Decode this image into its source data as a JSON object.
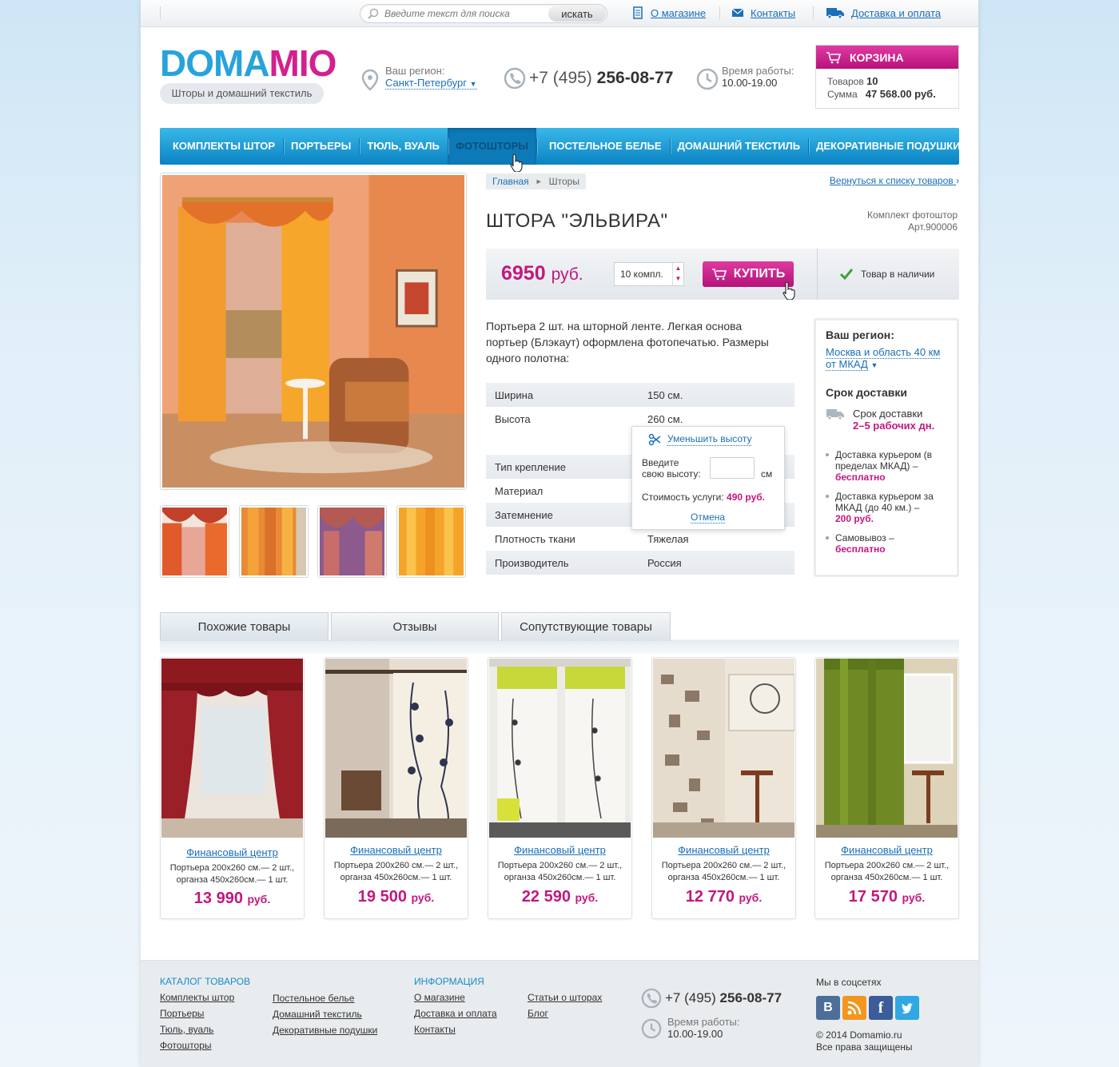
{
  "topbar": {
    "search_placeholder": "Введите текст для поиска",
    "search_button": "искать",
    "links": [
      "О магазине",
      "Контакты",
      "Доставка и оплата"
    ]
  },
  "header": {
    "logo_part1": "DOMA",
    "logo_part2": "MIO",
    "tagline": "Шторы и домашний текстиль",
    "region_label": "Ваш регион:",
    "region_value": "Санкт-Петербург",
    "phone_code": "+7 (495)",
    "phone_number": "256-08-77",
    "hours_label": "Время работы:",
    "hours_value": "10.00-19.00"
  },
  "cart": {
    "title": "КОРЗИНА",
    "items_label": "Товаров",
    "items_count": "10",
    "sum_label": "Сумма",
    "sum_value": "47 568.00 руб."
  },
  "nav": {
    "items": [
      "Комплекты штор",
      "Портьеры",
      "Тюль, вуаль",
      "Фотошторы",
      "Постельное белье",
      "Домашний текстиль",
      "Декоративные подушки"
    ],
    "active": "Фотошторы"
  },
  "breadcrumb": {
    "home": "Главная",
    "current": "Шторы"
  },
  "back_link": "Вернуться к списку товаров",
  "product": {
    "title": "ШТОРА \"ЭЛЬВИРА\"",
    "category": "Комплект фотоштор",
    "article": "Арт.900006",
    "price": "6950",
    "currency": "руб.",
    "quantity": "10 компл.",
    "buy_label": "КУПИТЬ",
    "stock": "Товар в наличии",
    "description": "Портьера 2 шт. на шторной ленте. Легкая основа портьер (Блэкаут) оформлена фотопечатью. Размеры одного полотна:",
    "specs": [
      {
        "key": "Ширина",
        "value": "150 см."
      },
      {
        "key": "Высота",
        "value": "260 см."
      },
      {
        "key": "",
        "value": ""
      },
      {
        "key": "Тип крепление",
        "value": ""
      },
      {
        "key": "Материал",
        "value": ""
      },
      {
        "key": "Затемнение",
        "value": ""
      },
      {
        "key": "Плотность ткани",
        "value": "Тяжелая"
      },
      {
        "key": "Производитель",
        "value": "Россия"
      }
    ]
  },
  "height_popup": {
    "title": "Уменьшить высоту",
    "label_line1": "Введите",
    "label_line2": "свою высоту:",
    "unit": "см",
    "cost_label": "Стоимость услуги:",
    "cost_value": "490 руб.",
    "cancel": "Отмена"
  },
  "delivery": {
    "region_title": "Ваш регион:",
    "region_line1": "Москва и область 40 км",
    "region_line2": "от МКАД",
    "term_title": "Срок доставки",
    "term_label": "Срок доставки",
    "term_value": "2–5 рабочих дн.",
    "options": [
      {
        "text": "Доставка курьером (в пределах МКАД) –",
        "price": "бесплатно"
      },
      {
        "text": "Доставка курьером за МКАД (до 40 км.) –",
        "price": "200 руб."
      },
      {
        "text": "Самовывоз –",
        "price": "бесплатно"
      }
    ]
  },
  "tabs": [
    "Похожие товары",
    "Отзывы",
    "Сопутствующие товары"
  ],
  "products": [
    {
      "name": "Финансовый центр",
      "line1": "Портьера 200х260 см.— 2 шт.,",
      "line2": "органза 450х260см.— 1 шт.",
      "price": "13 990",
      "currency": "руб."
    },
    {
      "name": "Финансовый центр",
      "line1": "Портьера 200х260 см.— 2 шт.,",
      "line2": "органза 450х260см.— 1 шт.",
      "price": "19 500",
      "currency": "руб."
    },
    {
      "name": "Финансовый центр",
      "line1": "Портьера 200х260 см.— 2 шт.,",
      "line2": "органза 450х260см.— 1 шт.",
      "price": "22 590",
      "currency": "руб."
    },
    {
      "name": "Финансовый центр",
      "line1": "Портьера 200х260 см.— 2 шт.,",
      "line2": "органза 450х260см.— 1 шт.",
      "price": "12 770",
      "currency": "руб."
    },
    {
      "name": "Финансовый центр",
      "line1": "Портьера 200х260 см.— 2 шт.,",
      "line2": "органза 450х260см.— 1 шт.",
      "price": "17 570",
      "currency": "руб."
    }
  ],
  "footer": {
    "catalog_title": "КАТАЛОГ ТОВАРОВ",
    "catalog_col1": [
      "Комплекты штор",
      "Портьеры",
      "Тюль, вуаль",
      "Фотошторы"
    ],
    "catalog_col2": [
      "Постельное белье",
      "Домашний текстиль",
      "Декоративные подушки"
    ],
    "info_title": "ИНФОРМАЦИЯ",
    "info_col1": [
      "О магазине",
      "Доставка и  оплата",
      "Контакты"
    ],
    "info_col2": [
      "Статьи о шторах",
      "Блог"
    ],
    "phone_code": "+7 (495)",
    "phone_number": "256-08-77",
    "hours_label": "Время работы:",
    "hours_value": "10.00-19.00",
    "social_title": "Мы в соцсетях",
    "copyright": "© 2014  Domamio.ru",
    "rights": "Все права защищены"
  },
  "colors": {
    "brand_blue": "#27a3dc",
    "brand_pink": "#d3208f",
    "price_pink": "#c2187f",
    "nav_blue": "#0b83c3",
    "link_blue": "#1a6fb8"
  }
}
